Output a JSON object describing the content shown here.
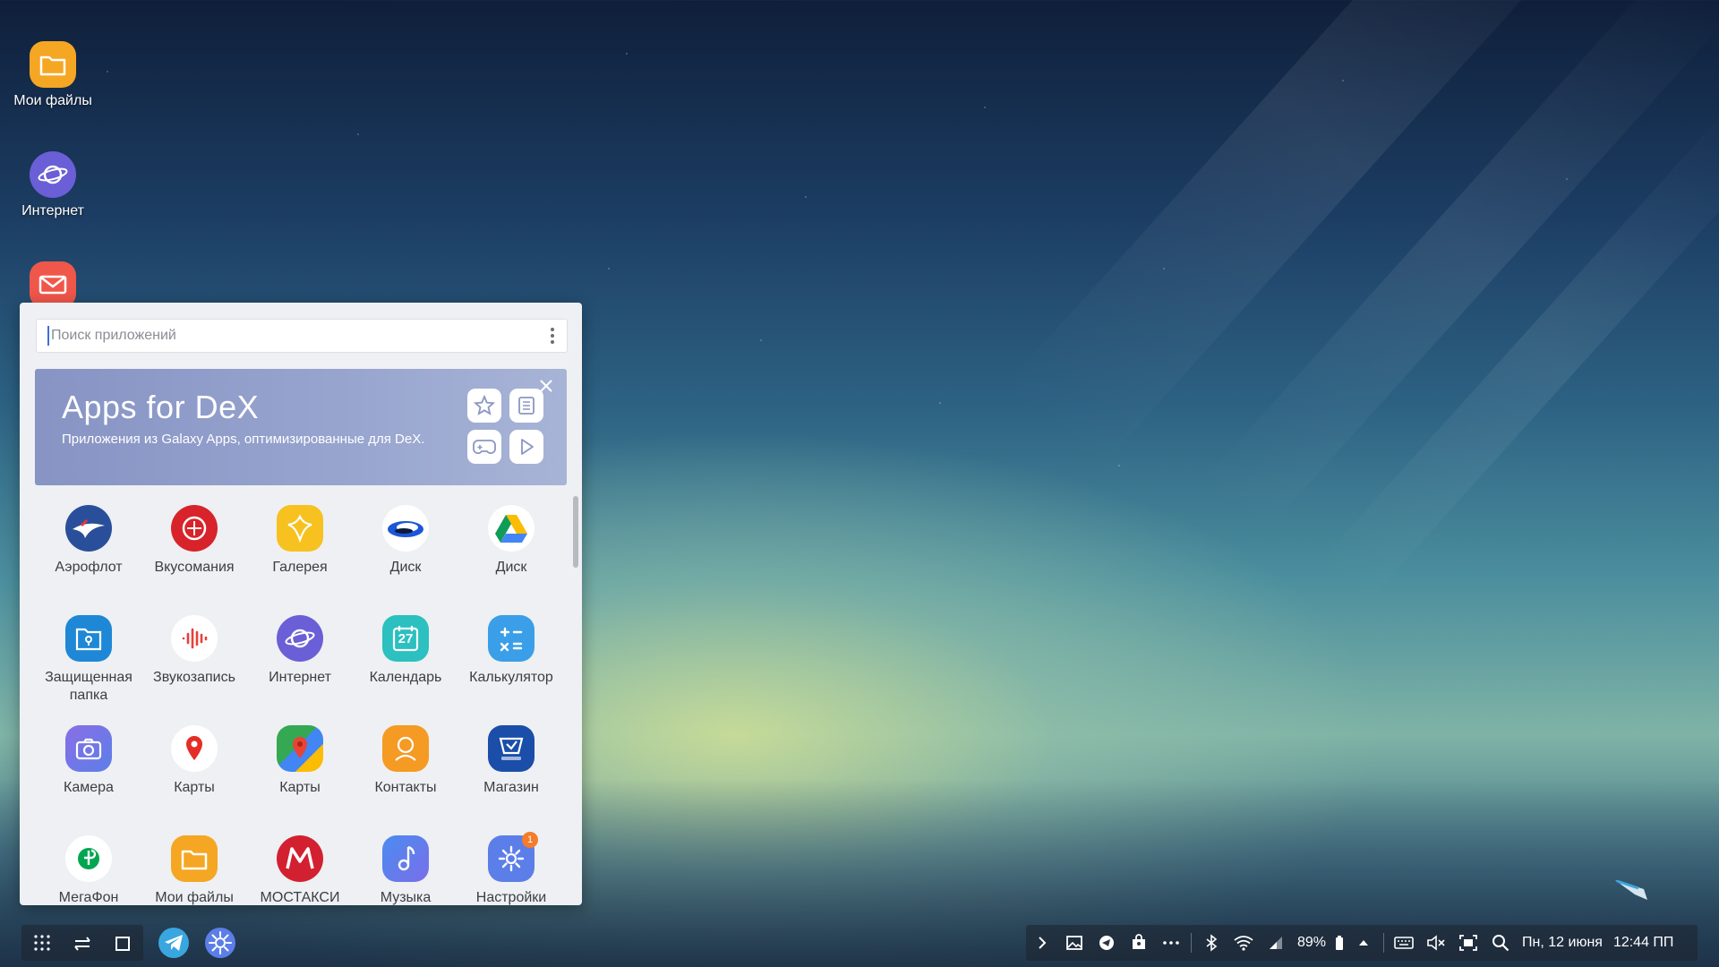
{
  "desktop": {
    "icons": [
      {
        "label": "Мои файлы",
        "icon": "folder-icon"
      },
      {
        "label": "Интернет",
        "icon": "internet-planet-icon"
      },
      {
        "label": "",
        "icon": "email-icon"
      }
    ]
  },
  "drawer": {
    "search_placeholder": "Поиск приложений",
    "banner": {
      "title": "Apps for DeX",
      "description": "Приложения из Galaxy Apps, оптимизированные для DeX."
    },
    "apps": [
      [
        {
          "label": "Аэрофлот",
          "icon": "aeroflot-icon"
        },
        {
          "label": "Вкусомания",
          "icon": "vkusomania-icon"
        },
        {
          "label": "Галерея",
          "icon": "gallery-icon"
        },
        {
          "label": "Диск",
          "icon": "yandex-disk-icon"
        },
        {
          "label": "Диск",
          "icon": "google-drive-icon"
        }
      ],
      [
        {
          "label": "Защищенная папка",
          "icon": "secure-folder-icon"
        },
        {
          "label": "Звукозапись",
          "icon": "voice-recorder-icon"
        },
        {
          "label": "Интернет",
          "icon": "internet-planet-icon"
        },
        {
          "label": "Календарь",
          "icon": "calendar-icon",
          "day": "27"
        },
        {
          "label": "Калькулятор",
          "icon": "calculator-icon"
        }
      ],
      [
        {
          "label": "Камера",
          "icon": "camera-icon"
        },
        {
          "label": "Карты",
          "icon": "yandex-maps-icon"
        },
        {
          "label": "Карты",
          "icon": "google-maps-icon"
        },
        {
          "label": "Контакты",
          "icon": "contacts-icon"
        },
        {
          "label": "Магазин",
          "icon": "galaxy-store-icon"
        }
      ],
      [
        {
          "label": "МегаФон",
          "icon": "megafon-icon"
        },
        {
          "label": "Мои файлы",
          "icon": "folder-icon"
        },
        {
          "label": "МОСТАКСИ",
          "icon": "mostaxi-icon"
        },
        {
          "label": "Музыка",
          "icon": "music-icon"
        },
        {
          "label": "Настройки",
          "icon": "settings-gear-icon",
          "badge": "1"
        }
      ]
    ]
  },
  "taskbar": {
    "running_apps": [
      "telegram-icon",
      "settings-gear-icon"
    ],
    "battery": "89%",
    "date": "Пн, 12 июня",
    "time": "12:44 ПП"
  }
}
